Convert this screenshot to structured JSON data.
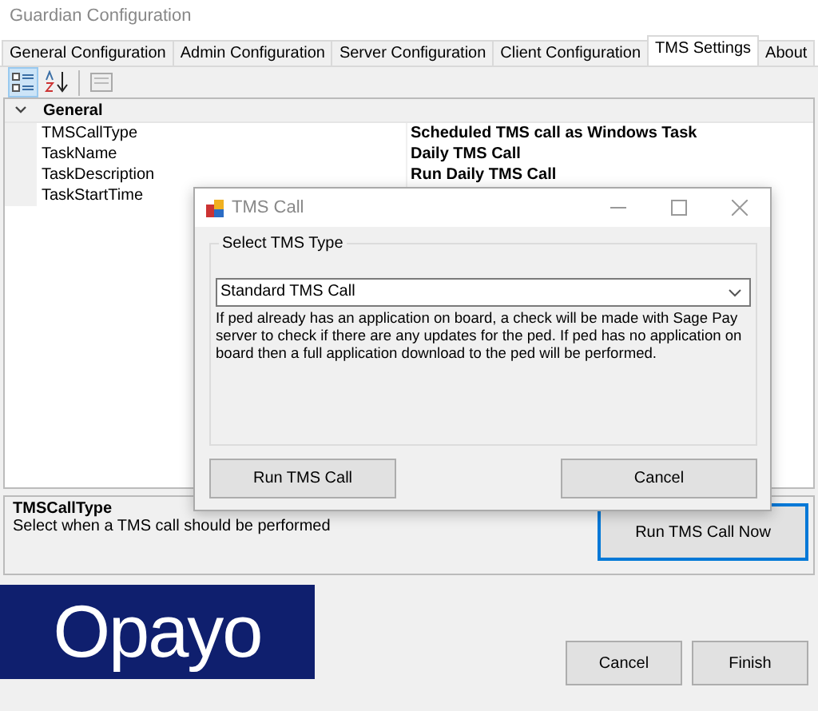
{
  "window": {
    "title": "Guardian Configuration"
  },
  "tabs": [
    {
      "label": "General Configuration",
      "selected": false
    },
    {
      "label": "Admin Configuration",
      "selected": false
    },
    {
      "label": "Server Configuration",
      "selected": false
    },
    {
      "label": "Client Configuration",
      "selected": false
    },
    {
      "label": "TMS Settings",
      "selected": true
    },
    {
      "label": "About",
      "selected": false
    }
  ],
  "toolbar": [
    {
      "kind": "categorized",
      "selected": true
    },
    {
      "kind": "alphabetical",
      "selected": false
    },
    {
      "kind": "pages",
      "selected": false
    }
  ],
  "property_grid": {
    "category": {
      "label": "General",
      "expanded": true
    },
    "rows": [
      {
        "name": "TMSCallType",
        "value": "Scheduled TMS call as Windows Task"
      },
      {
        "name": "TaskName",
        "value": "Daily TMS Call"
      },
      {
        "name": "TaskDescription",
        "value": "Run Daily TMS Call"
      },
      {
        "name": "TaskStartTime",
        "value": ""
      }
    ]
  },
  "description": {
    "title": "TMSCallType",
    "text": "Select when a TMS call should be performed"
  },
  "run_now_button": "Run TMS Call Now",
  "logo": "Opayo",
  "buttons": [
    "Cancel",
    "Finish"
  ],
  "dialog": {
    "title": "TMS Call",
    "group_label": "Select TMS Type",
    "select_value": "Standard TMS Call",
    "help_text": "If ped already has an application on board, a check will be made with Sage Pay server to check if there are any updates for the ped. If ped has no application on board then a full application download to the ped will be performed.",
    "buttons": [
      "Run TMS Call",
      "Cancel"
    ]
  }
}
